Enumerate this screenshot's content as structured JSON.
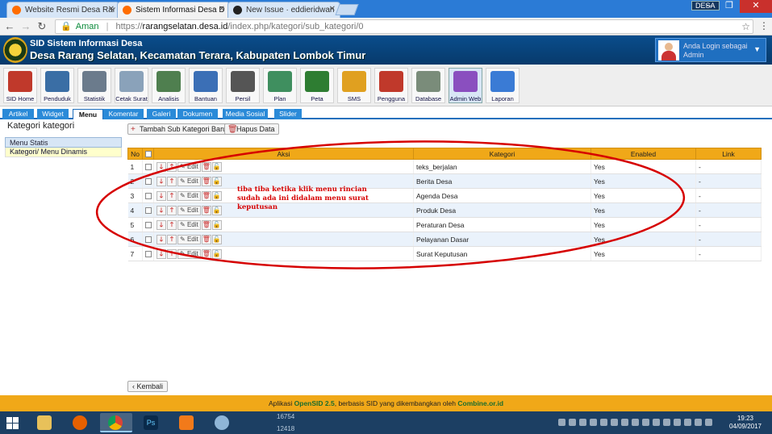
{
  "browser": {
    "tabs": [
      {
        "label": "Website Resmi Desa Rar",
        "favicon_color": "#ff6d00"
      },
      {
        "label": "Sistem Informasi Desa D",
        "favicon_color": "#ff6d00"
      },
      {
        "label": "New Issue · eddieridwan",
        "favicon_color": "#222222"
      }
    ],
    "badge": "DESA",
    "security_label": "Aman",
    "url_host": "rarangselatan.desa.id",
    "url_scheme": "https://",
    "url_path": "/index.php/kategori/sub_kategori/0"
  },
  "app": {
    "title": "SID Sistem Informasi Desa",
    "subtitle": "Desa Rarang Selatan, Kecamatan Terara, Kabupaten Lombok Timur",
    "user_label": "Anda Login sebagai",
    "user_role": "Admin"
  },
  "toolbar": [
    {
      "label": "SID Home",
      "icon": "home-icon",
      "color": "#c0392b"
    },
    {
      "label": "Penduduk",
      "icon": "people-icon",
      "color": "#3a6ea5"
    },
    {
      "label": "Statistik",
      "icon": "stats-icon",
      "color": "#6b7b8c"
    },
    {
      "label": "Cetak Surat",
      "icon": "printer-icon",
      "color": "#8aa2ba"
    },
    {
      "label": "Analisis",
      "icon": "analysis-icon",
      "color": "#4f7f4f"
    },
    {
      "label": "Bantuan",
      "icon": "help-icon",
      "color": "#3b6fb6"
    },
    {
      "label": "Persil",
      "icon": "map-pin-icon",
      "color": "#555555"
    },
    {
      "label": "Plan",
      "icon": "plan-icon",
      "color": "#3f8f5f"
    },
    {
      "label": "Peta",
      "icon": "globe-icon",
      "color": "#2e7d32"
    },
    {
      "label": "SMS",
      "icon": "sms-icon",
      "color": "#e0a020"
    },
    {
      "label": "Pengguna",
      "icon": "users-icon",
      "color": "#c0392b"
    },
    {
      "label": "Database",
      "icon": "database-icon",
      "color": "#7a8c7a"
    },
    {
      "label": "Admin Web",
      "icon": "admin-web-icon",
      "color": "#8a4fbf"
    },
    {
      "label": "Laporan",
      "icon": "envelope-icon",
      "color": "#3a7bd5"
    }
  ],
  "modtabs": [
    "Artikel",
    "Widget",
    "Menu",
    "Komentar",
    "Galeri",
    "Dokumen",
    "Media Sosial",
    "Slider"
  ],
  "active_modtab": "Menu",
  "sidebar": {
    "title": "Kategori kategori",
    "section": "Menu Statis",
    "item": "Kategori/ Menu Dinamis"
  },
  "actions": {
    "add_label": "Tambah Sub Kategori Baru",
    "delete_label": "Hapus Data",
    "back_label": "Kembali"
  },
  "table": {
    "headers": [
      "No",
      "",
      "Aksi",
      "Kategori",
      "Enabled",
      "Link"
    ],
    "edit_label": "Edit",
    "rows": [
      {
        "no": "1",
        "kategori": "teks_berjalan",
        "enabled": "Yes",
        "link": "-"
      },
      {
        "no": "2",
        "kategori": "Berita Desa",
        "enabled": "Yes",
        "link": "-"
      },
      {
        "no": "3",
        "kategori": "Agenda Desa",
        "enabled": "Yes",
        "link": "-"
      },
      {
        "no": "4",
        "kategori": "Produk Desa",
        "enabled": "Yes",
        "link": "-"
      },
      {
        "no": "5",
        "kategori": "Peraturan Desa",
        "enabled": "Yes",
        "link": "-"
      },
      {
        "no": "6",
        "kategori": "Pelayanan Dasar",
        "enabled": "Yes",
        "link": "-"
      },
      {
        "no": "7",
        "kategori": "Surat Keputusan",
        "enabled": "Yes",
        "link": "-"
      }
    ]
  },
  "annotation": {
    "text": "tiba tiba ketika klik menu rincian sudah ada ini didalam menu surat keputusan",
    "color": "#d60000"
  },
  "footer": {
    "prefix": "Aplikasi",
    "app_name": "OpenSID 2.5",
    "middle": ", berbasis SID yang dikembangkan oleh",
    "dev": "Combine.or.id"
  },
  "taskbar": {
    "numbers": [
      "16754",
      "12418"
    ],
    "time": "19:23",
    "date": "04/09/2017"
  }
}
